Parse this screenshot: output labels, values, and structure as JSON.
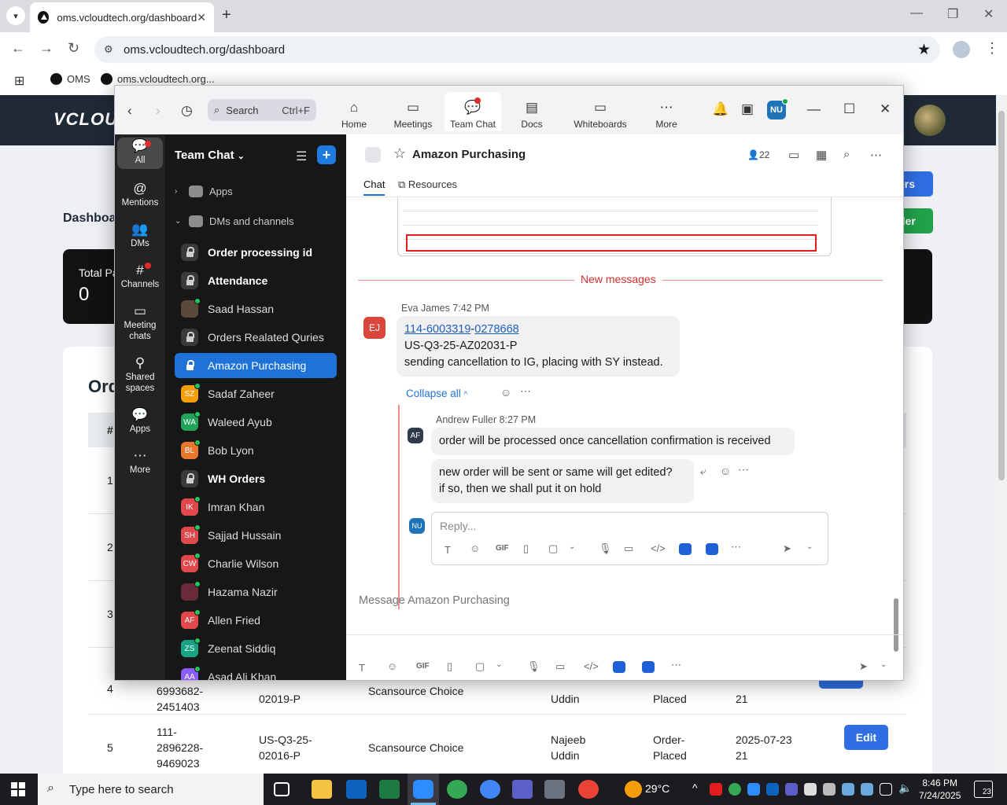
{
  "browser": {
    "tab_title": "oms.vcloudtech.org/dashboard",
    "url": "oms.vcloudtech.org/dashboard",
    "bookmarks": [
      "OMS",
      "oms.vcloudtech.org..."
    ]
  },
  "webpage": {
    "logo": "VCLOUD",
    "dashboard_title": "Dashboa",
    "btn_blue": "ers",
    "btn_green": "der",
    "card_label": "Total Pa",
    "card_value": "0",
    "orders_title": "Ord",
    "table_header_num": "#",
    "rows": [
      {
        "num": "1"
      },
      {
        "num": "2"
      },
      {
        "num": "3"
      },
      {
        "num": "4",
        "order_l1": "6993682-",
        "order_l2": "2451403",
        "ref": "02019-P",
        "vendor": "Scansource Choice",
        "user": "Uddin",
        "status": "Placed",
        "date": "21"
      },
      {
        "num": "5",
        "order_l0": "111-",
        "order_l1": "2896228-",
        "order_l2": "9469023",
        "ref_l1": "US-Q3-25-",
        "ref": "02016-P",
        "vendor": "Scansource Choice",
        "user_l1": "Najeeb",
        "user": "Uddin",
        "status_l1": "Order-",
        "status": "Placed",
        "date_l1": "2025-07-23",
        "date": "21",
        "edit": "Edit"
      }
    ]
  },
  "zoom": {
    "search_placeholder": "Search",
    "search_shortcut": "Ctrl+F",
    "tabs": [
      "Home",
      "Meetings",
      "Team Chat",
      "Docs",
      "Whiteboards",
      "More"
    ],
    "avatar": "NU",
    "rail": [
      "All",
      "Mentions",
      "DMs",
      "Channels",
      "Meeting chats",
      "Shared spaces",
      "Apps",
      "More"
    ],
    "sidebar": {
      "title": "Team Chat",
      "sec_apps": "Apps",
      "sec_dms": "DMs and channels",
      "items": [
        {
          "label": "Order processing id",
          "kind": "lock",
          "bold": true
        },
        {
          "label": "Attendance",
          "kind": "lock",
          "bold": true
        },
        {
          "label": "Saad Hassan",
          "kind": "photo",
          "initials": "",
          "color": "#5a4a3a"
        },
        {
          "label": "Orders Realated Quries",
          "kind": "lock"
        },
        {
          "label": "Amazon Purchasing",
          "kind": "lock",
          "active": true
        },
        {
          "label": "Sadaf Zaheer",
          "initials": "SZ",
          "color": "#f59e0b"
        },
        {
          "label": "Waleed Ayub",
          "initials": "WA",
          "color": "#22a35a"
        },
        {
          "label": "Bob Lyon",
          "initials": "BL",
          "color": "#e8762c"
        },
        {
          "label": "WH Orders",
          "kind": "lock",
          "bold": true
        },
        {
          "label": "Imran Khan",
          "initials": "IK",
          "color": "#e0484b"
        },
        {
          "label": "Sajjad Hussain",
          "initials": "SH",
          "color": "#e0484b"
        },
        {
          "label": "Charlie Wilson",
          "initials": "CW",
          "color": "#e0484b"
        },
        {
          "label": "Hazama Nazir",
          "kind": "photo",
          "initials": "",
          "color": "#6b2a3a"
        },
        {
          "label": "Allen Fried",
          "initials": "AF",
          "color": "#e0484b"
        },
        {
          "label": "Zeenat Siddiq",
          "initials": "ZS",
          "color": "#18a383"
        },
        {
          "label": "Asad Ali Khan",
          "initials": "AA",
          "color": "#8b5cf6"
        }
      ]
    },
    "channel": {
      "title": "Amazon Purchasing",
      "members": "22",
      "subtab_chat": "Chat",
      "subtab_resources": "Resources",
      "new_messages": "New messages",
      "msg1": {
        "initials": "EJ",
        "sender": "Eva James",
        "time": "7:42 PM",
        "link1": "114-6003319",
        "dash": "-",
        "link2": "0278668",
        "line2": "US-Q3-25-AZ02031-P",
        "line3": "sending cancellation to IG, placing with SY instead."
      },
      "collapse": "Collapse all",
      "reply": {
        "initials": "AF",
        "sender": "Andrew Fuller",
        "time": "8:27 PM",
        "bubble1": "order will be processed once cancellation confirmation is received",
        "bubble2_l1": "new order will be sent or same will get edited?",
        "bubble2_l2": "if so, then we shall put it on hold"
      },
      "reply_avatar": "NU",
      "reply_placeholder": "Reply...",
      "compose_placeholder": "Message Amazon Purchasing",
      "gif": "GIF"
    }
  },
  "taskbar": {
    "search_placeholder": "Type here to search",
    "weather": "29°C",
    "time": "8:46 PM",
    "date": "7/24/2025",
    "notifications": "23"
  }
}
